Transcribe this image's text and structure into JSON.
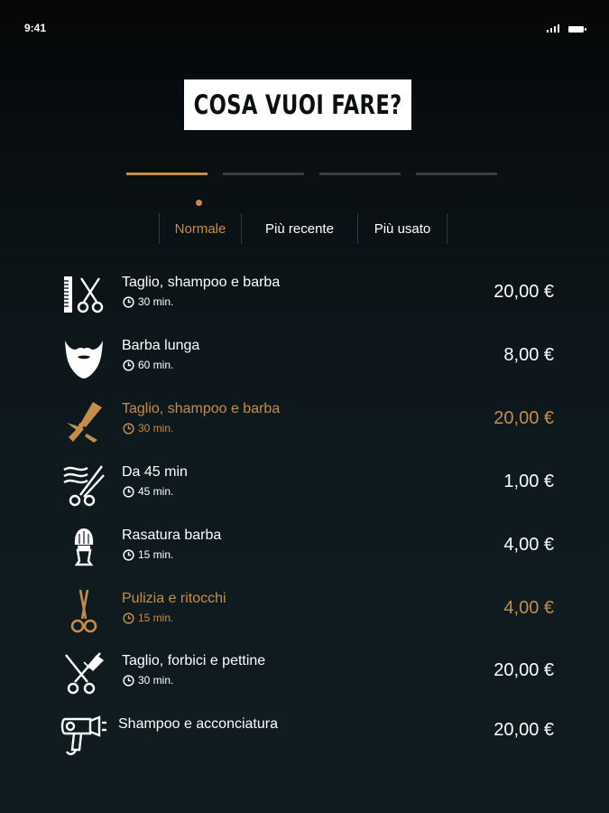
{
  "status_bar": {
    "time": "9:41",
    "icons": [
      "signal-icon",
      "battery-icon"
    ]
  },
  "header": {
    "title": "COSA VUOI FARE?"
  },
  "stepper": {
    "total_steps": 4,
    "active_step": 1
  },
  "sort_tabs": {
    "items": [
      {
        "label": "Normale",
        "active": true
      },
      {
        "label": "Più recente",
        "active": false
      },
      {
        "label": "Più usato",
        "active": false
      }
    ]
  },
  "services": [
    {
      "name": "Taglio, shampoo e barba",
      "duration": "30 min.",
      "price": "20,00 €",
      "icon": "comb-scissors-icon",
      "highlighted": false
    },
    {
      "name": "Barba lunga",
      "duration": "60 min.",
      "price": "8,00 €",
      "icon": "beard-icon",
      "highlighted": false
    },
    {
      "name": "Taglio, shampoo e barba",
      "duration": "30 min.",
      "price": "20,00 €",
      "icon": "straight-razor-icon",
      "highlighted": true
    },
    {
      "name": "Da 45 min",
      "duration": "45 min.",
      "price": "1,00 €",
      "icon": "hair-cut-scissors-icon",
      "highlighted": false
    },
    {
      "name": "Rasatura barba",
      "duration": "15 min.",
      "price": "4,00 €",
      "icon": "shaving-brush-icon",
      "highlighted": false
    },
    {
      "name": "Pulizia e ritocchi",
      "duration": "15 min.",
      "price": "4,00 €",
      "icon": "scissors-icon",
      "highlighted": true
    },
    {
      "name": "Taglio, forbici e pettine",
      "duration": "30 min.",
      "price": "20,00 €",
      "icon": "scissors-comb-icon",
      "highlighted": false
    },
    {
      "name": "Shampoo e acconciatura",
      "duration": "",
      "price": "20,00 €",
      "icon": "hair-dryer-icon",
      "highlighted": false
    }
  ],
  "colors": {
    "accent": "#c58d4b",
    "text": "#ffffff",
    "background_top": "#050607",
    "background_bottom": "#101c21",
    "inactive_step": "#3a3f42"
  }
}
